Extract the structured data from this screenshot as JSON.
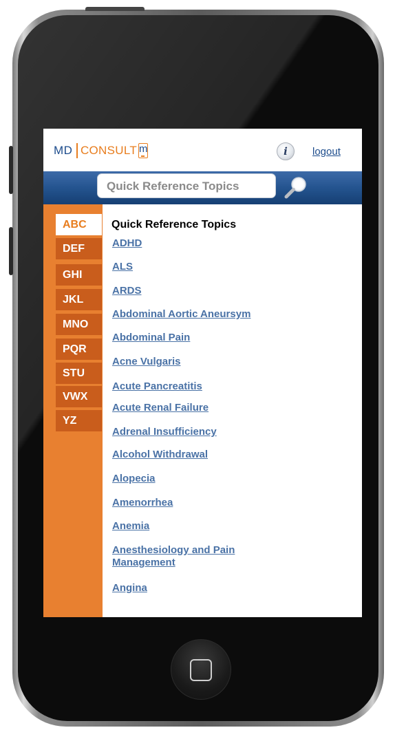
{
  "header": {
    "logo_md": "MD",
    "logo_consult": "CONSULT",
    "logo_m": "m",
    "info_label": "i",
    "logout_label": "logout"
  },
  "search": {
    "placeholder": "Quick Reference Topics"
  },
  "sidebar": {
    "items": [
      {
        "label": "ABC",
        "active": true
      },
      {
        "label": "DEF"
      },
      {
        "label": "GHI"
      },
      {
        "label": "JKL"
      },
      {
        "label": "MNO"
      },
      {
        "label": "PQR"
      },
      {
        "label": "STU"
      },
      {
        "label": "VWX"
      },
      {
        "label": "YZ"
      }
    ]
  },
  "main": {
    "title": "Quick Reference Topics",
    "topics": [
      "ADHD",
      "ALS",
      "ARDS",
      "Abdominal Aortic Aneursym",
      "Abdominal Pain",
      "Acne Vulgaris",
      "Acute Pancreatitis",
      "Acute Renal Failure",
      "Adrenal Insufficiency",
      "Alcohol Withdrawal",
      "Alopecia",
      "Amenorrhea",
      "Anemia",
      "Anesthesiology and Pain Management",
      "Angina"
    ]
  },
  "colors": {
    "accent_orange": "#e87d1e",
    "sidebar_dark": "#c95d1c",
    "brand_blue": "#1d4c8c",
    "link_blue": "#4a72a6"
  }
}
